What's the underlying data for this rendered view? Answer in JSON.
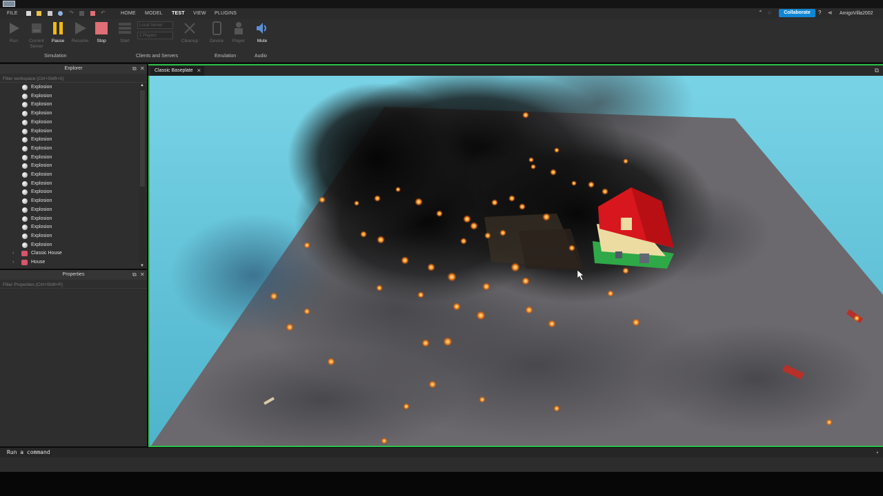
{
  "menu": {
    "file": "FILE",
    "tabs": [
      "HOME",
      "MODEL",
      "TEST",
      "VIEW",
      "PLUGINS"
    ],
    "active_tab": "TEST",
    "collaborate": "Collaborate",
    "username": "AmigoVilla2002"
  },
  "ribbon": {
    "buttons": {
      "run": "Run",
      "current_server": "Current Server",
      "pause": "Pause",
      "resume": "Resume",
      "stop": "Stop",
      "start": "Start",
      "cleanup": "Cleanup",
      "device": "Device",
      "player": "Player",
      "mute": "Mute"
    },
    "dropdowns": {
      "local_server": "Local Server",
      "players": "2 Players"
    },
    "groups": {
      "simulation": "Simulation",
      "clients_servers": "Clients and Servers",
      "emulation": "Emulation",
      "audio": "Audio"
    }
  },
  "explorer": {
    "title": "Explorer",
    "filter_placeholder": "Filter workspace (Ctrl+Shift+X)",
    "items": [
      {
        "label": "Explosion"
      },
      {
        "label": "Explosion"
      },
      {
        "label": "Explosion"
      },
      {
        "label": "Explosion"
      },
      {
        "label": "Explosion"
      },
      {
        "label": "Explosion"
      },
      {
        "label": "Explosion"
      },
      {
        "label": "Explosion"
      },
      {
        "label": "Explosion"
      },
      {
        "label": "Explosion"
      },
      {
        "label": "Explosion"
      },
      {
        "label": "Explosion"
      },
      {
        "label": "Explosion"
      },
      {
        "label": "Explosion"
      },
      {
        "label": "Explosion"
      },
      {
        "label": "Explosion"
      },
      {
        "label": "Explosion"
      },
      {
        "label": "Explosion"
      },
      {
        "label": "Explosion"
      }
    ],
    "models": [
      {
        "label": "Classic House"
      },
      {
        "label": "House"
      }
    ]
  },
  "properties": {
    "title": "Properties",
    "filter_placeholder": "Filter Properties (Ctrl+Shift+P)"
  },
  "document": {
    "tab_label": "Classic Baseplate"
  },
  "command_bar": {
    "placeholder": "Run a command"
  },
  "colors": {
    "accent_green": "#2cc14a",
    "collab_blue": "#0f87d6",
    "pause_yellow": "#f2b90f",
    "stop_red": "#e06e76"
  }
}
